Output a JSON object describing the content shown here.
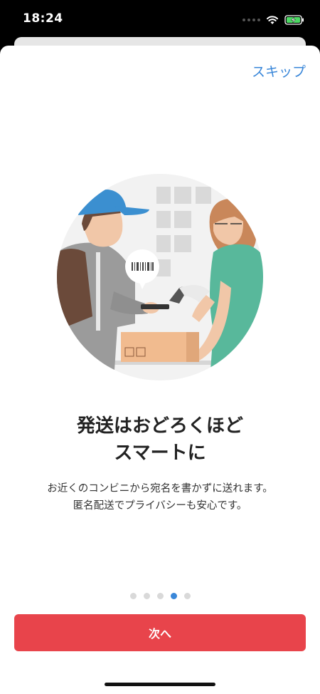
{
  "status_bar": {
    "time": "18:24"
  },
  "onboarding": {
    "skip_label": "スキップ",
    "heading_line1": "発送はおどろくほど",
    "heading_line2": "スマートに",
    "description_line1": "お近くのコンビニから宛名を書かずに送れます。",
    "description_line2": "匿名配送でプライバシーも安心です。",
    "page_count": 5,
    "current_page": 4,
    "next_label": "次へ"
  },
  "colors": {
    "accent_blue": "#3a87d9",
    "button_red": "#e8444b",
    "dot_inactive": "#d9d9d9"
  }
}
